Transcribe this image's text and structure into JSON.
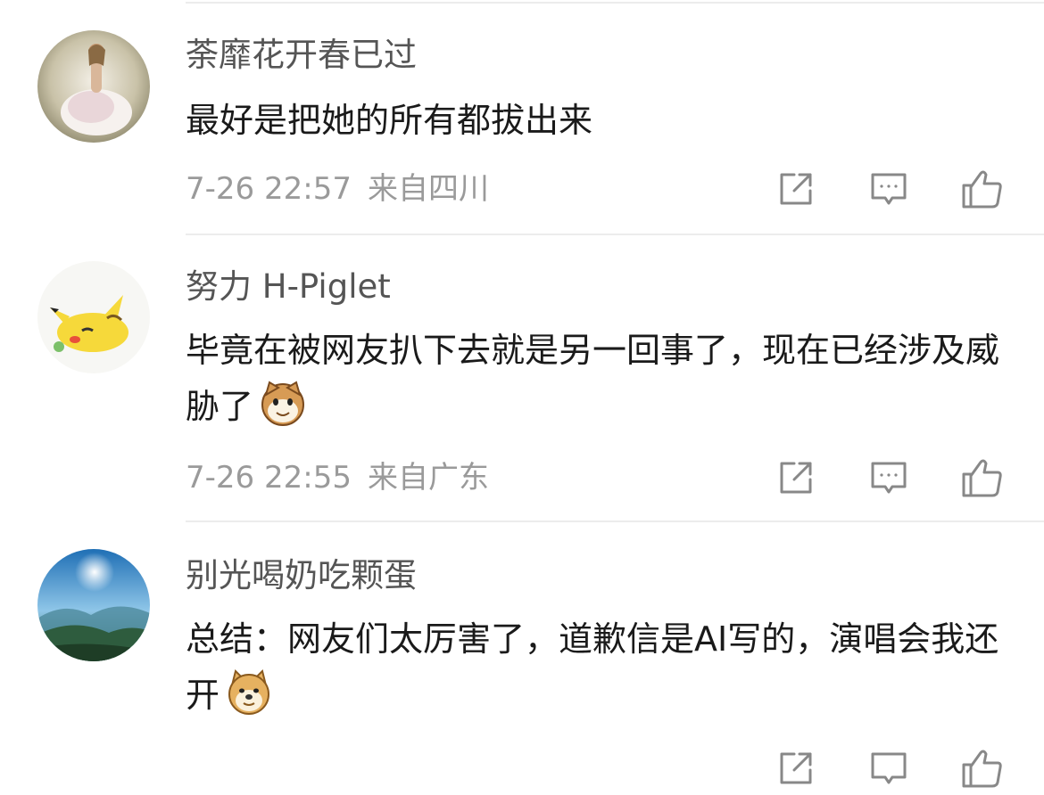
{
  "comments": [
    {
      "username": "荼靡花开春已过",
      "text": "最好是把她的所有都拔出来",
      "time": "7-26 22:57",
      "location": "来自四川",
      "avatar": "woman-in-white-dress-avatar"
    },
    {
      "username": "努力 H-Piglet",
      "text": "毕竟在被网友扒下去就是另一回事了，现在已经涉及威胁了",
      "emoji": "cat-face-emoji",
      "time": "7-26 22:55",
      "location": "来自广东",
      "avatar": "sleeping-pikachu-avatar"
    },
    {
      "username": "别光喝奶吃颗蛋",
      "text": "总结：网友们太厉害了，道歉信是AI写的，演唱会我还开",
      "emoji": "doge-emoji",
      "avatar": "mountain-sky-landscape-avatar"
    }
  ],
  "icons": {
    "share": "share-icon",
    "comment": "comment-icon",
    "like": "like-icon"
  },
  "colors": {
    "username": "#555555",
    "text": "#1a1a1a",
    "meta": "#9a9a9a",
    "icon": "#888888",
    "divider": "#ececec"
  }
}
